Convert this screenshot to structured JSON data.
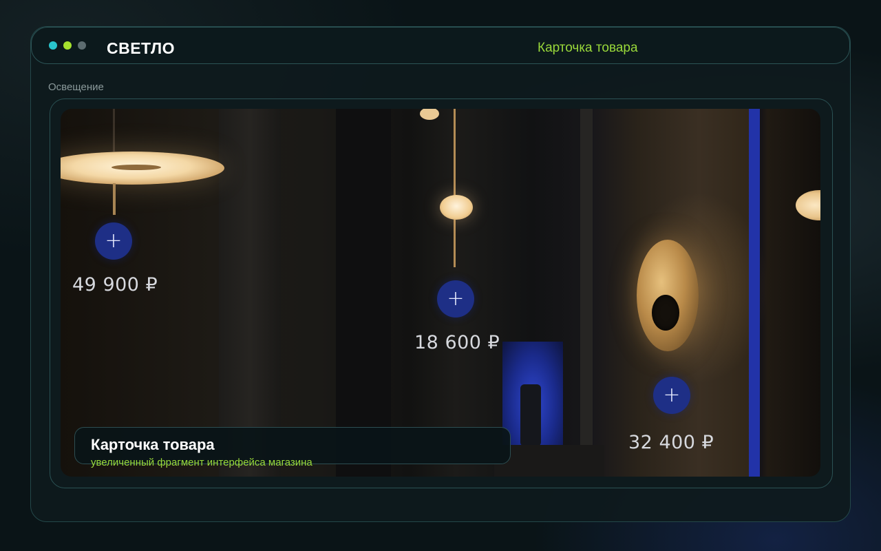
{
  "window": {
    "brand": "СВЕТЛО",
    "breadcrumb": "Карточка товара"
  },
  "section": {
    "label": "Освещение"
  },
  "products": [
    {
      "price": "49 900 ₽",
      "add_icon": "plus-icon",
      "add_glyph": "+"
    },
    {
      "price": "18 600 ₽",
      "add_icon": "plus-icon",
      "add_glyph": "+"
    },
    {
      "price": "32 400 ₽",
      "add_icon": "plus-icon",
      "add_glyph": "+"
    }
  ],
  "caption": {
    "title": "Карточка товара",
    "subtitle": "увеличенный фрагмент интерфейса магазина"
  },
  "colors": {
    "accent": "#9ad93a",
    "button": "#1e2f86",
    "window_dots": [
      "#29c4cc",
      "#a6e22e",
      "#5d6c70"
    ]
  }
}
